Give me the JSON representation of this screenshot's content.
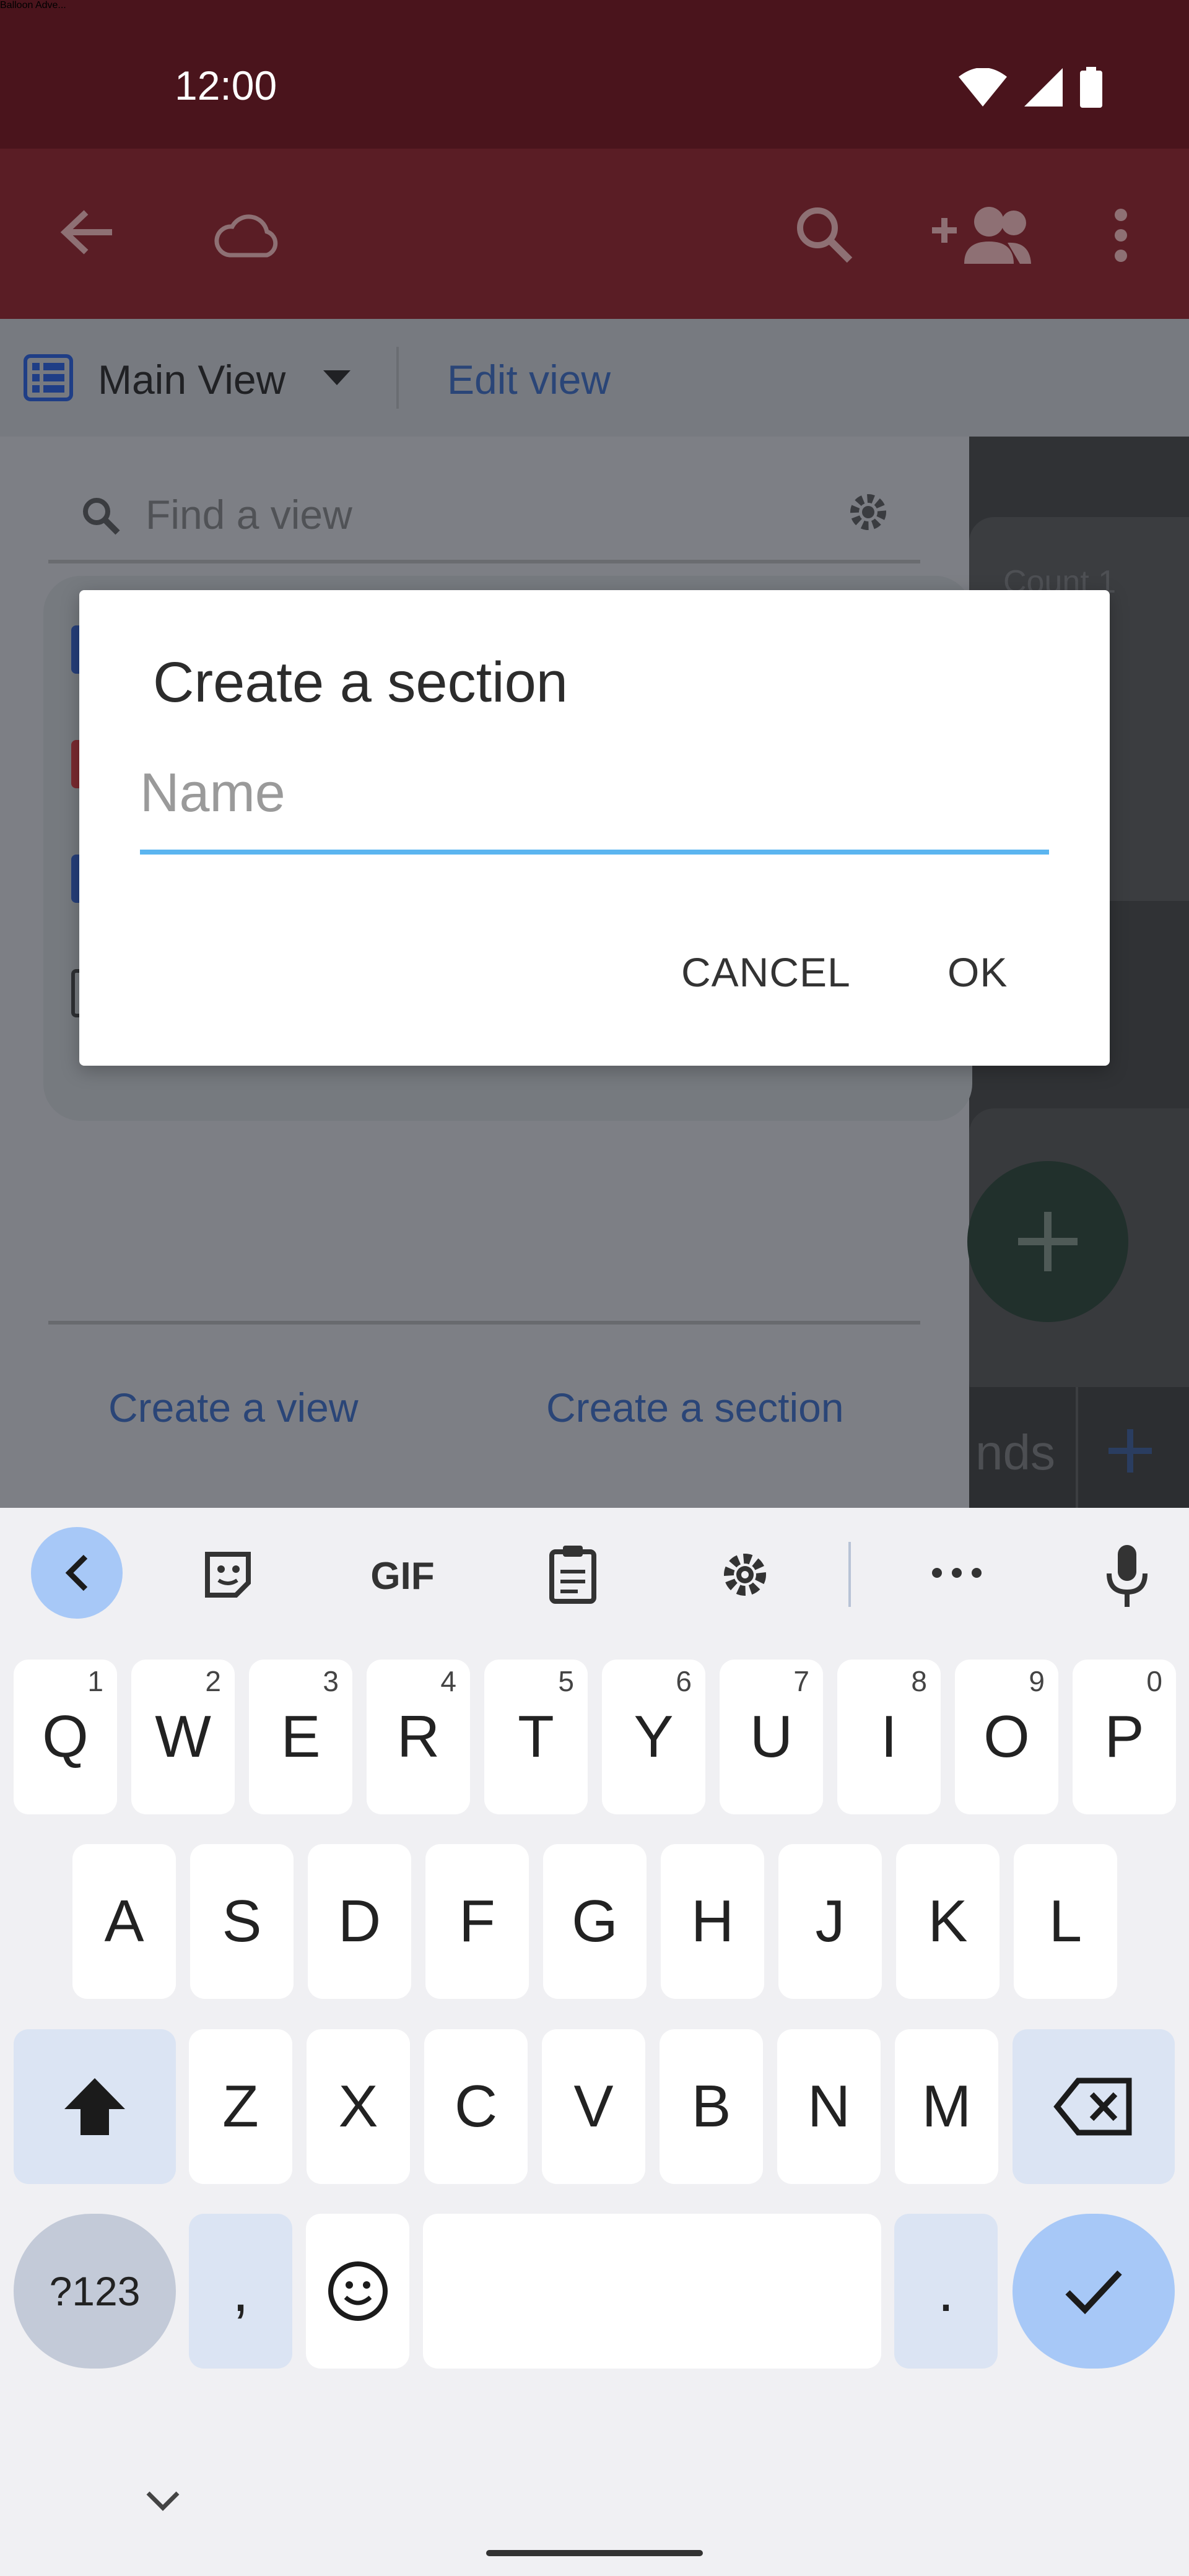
{
  "status_bar": {
    "time": "12:00"
  },
  "app_bar": {
    "title": "Balloon Adve..."
  },
  "view_toolbar": {
    "view_name": "Main View",
    "edit_label": "Edit view"
  },
  "find_view": {
    "placeholder": "Find a view"
  },
  "right_panel": {
    "count_label": "Count 1",
    "tab_text": "nds"
  },
  "bottom_links": {
    "create_view": "Create a view",
    "create_section": "Create a section"
  },
  "dialog": {
    "title": "Create a section",
    "name_placeholder": "Name",
    "cancel_label": "CANCEL",
    "ok_label": "OK"
  },
  "keyboard": {
    "toolbar": {
      "gif_label": "GIF"
    },
    "row1": [
      {
        "k": "Q",
        "s": "1"
      },
      {
        "k": "W",
        "s": "2"
      },
      {
        "k": "E",
        "s": "3"
      },
      {
        "k": "R",
        "s": "4"
      },
      {
        "k": "T",
        "s": "5"
      },
      {
        "k": "Y",
        "s": "6"
      },
      {
        "k": "U",
        "s": "7"
      },
      {
        "k": "I",
        "s": "8"
      },
      {
        "k": "O",
        "s": "9"
      },
      {
        "k": "P",
        "s": "0"
      }
    ],
    "row2": [
      "A",
      "S",
      "D",
      "F",
      "G",
      "H",
      "J",
      "K",
      "L"
    ],
    "row3": [
      "Z",
      "X",
      "C",
      "V",
      "B",
      "N",
      "M"
    ],
    "symbols_label": "?123",
    "comma_label": ",",
    "period_label": "."
  },
  "colors": {
    "status_bar": "#4a141c",
    "app_bar": "#5a1d25",
    "input_focus": "#5bb5f0",
    "link": "#2a4577",
    "enter_key": "#a7c8f7"
  }
}
